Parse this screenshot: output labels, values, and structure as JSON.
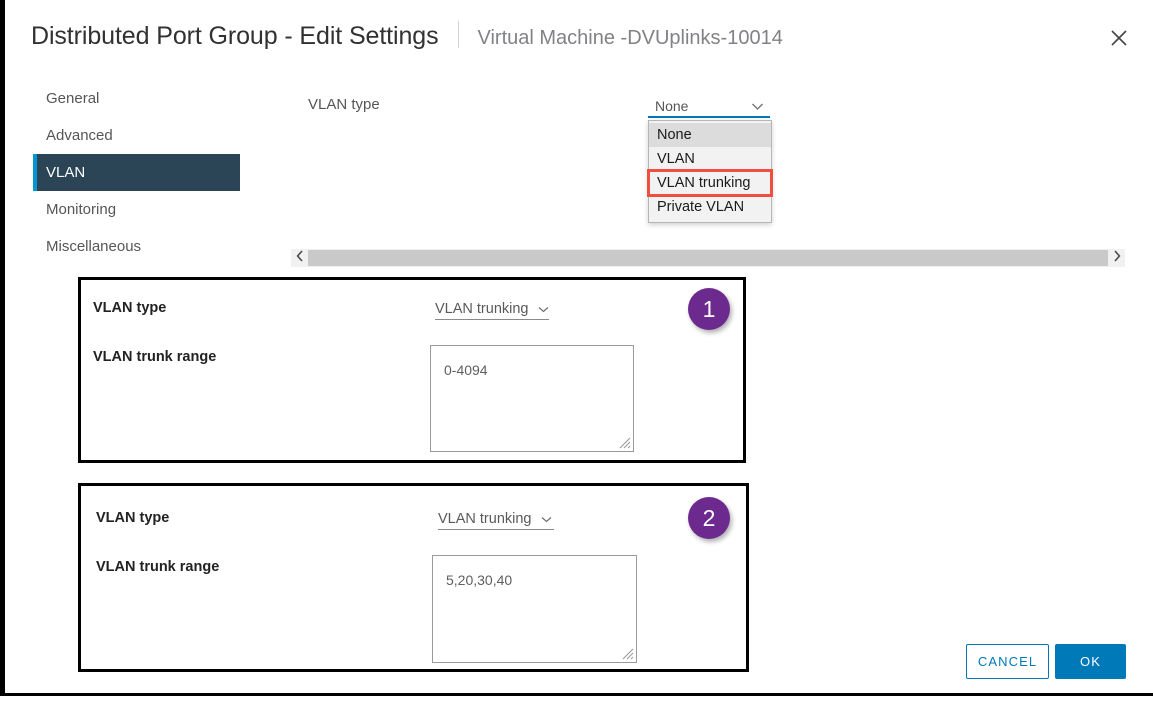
{
  "header": {
    "title": "Distributed Port Group - Edit Settings",
    "subtitle": "Virtual Machine -DVUplinks-10014",
    "close_icon": "close-icon"
  },
  "sidebar": {
    "items": [
      {
        "label": "General",
        "selected": false
      },
      {
        "label": "Advanced",
        "selected": false
      },
      {
        "label": "VLAN",
        "selected": true
      },
      {
        "label": "Monitoring",
        "selected": false
      },
      {
        "label": "Miscellaneous",
        "selected": false
      }
    ]
  },
  "main": {
    "vlan_type_label": "VLAN type",
    "vlan_type_value": "None",
    "dropdown_options": [
      {
        "label": "None",
        "hovered": true,
        "marked": false
      },
      {
        "label": "VLAN",
        "hovered": false,
        "marked": false
      },
      {
        "label": "VLAN trunking",
        "hovered": false,
        "marked": true
      },
      {
        "label": "Private VLAN",
        "hovered": false,
        "marked": false
      }
    ]
  },
  "scrollbar": {
    "left_arrow": "chevron-left-icon",
    "right_arrow": "chevron-right-icon"
  },
  "panels": [
    {
      "badge": "1",
      "vlan_type_label": "VLAN type",
      "vlan_type_value": "VLAN trunking",
      "trunk_range_label": "VLAN trunk range",
      "trunk_range_value": "0-4094"
    },
    {
      "badge": "2",
      "vlan_type_label": "VLAN type",
      "vlan_type_value": "VLAN trunking",
      "trunk_range_label": "VLAN trunk range",
      "trunk_range_value": "5,20,30,40"
    }
  ],
  "footer": {
    "cancel_label": "CANCEL",
    "ok_label": "OK"
  },
  "colors": {
    "accent_blue": "#0079b8",
    "nav_selected_bg": "#2b4456",
    "nav_selected_bar": "#0095d3",
    "badge_purple": "#6d2a8e",
    "highlight_red": "#f04e3e"
  }
}
